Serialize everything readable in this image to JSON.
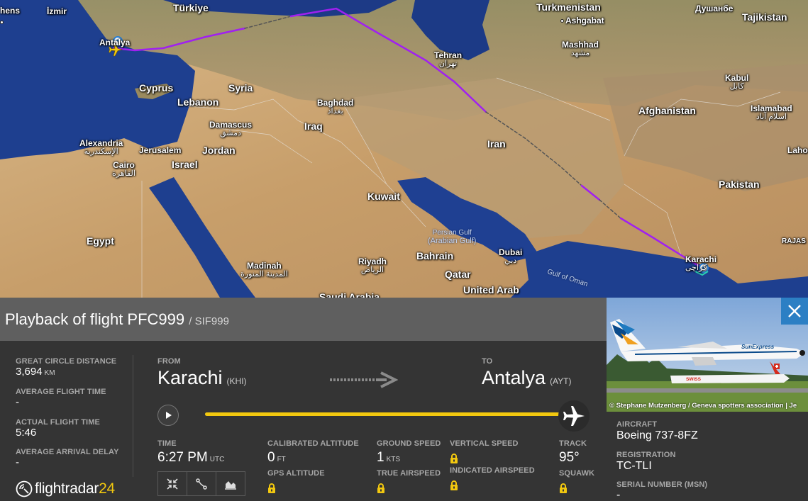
{
  "map": {
    "countries": [
      {
        "key": "turkiye",
        "name": "Türkiye"
      },
      {
        "key": "turkmenistan",
        "name": "Turkmenistan"
      },
      {
        "key": "tajikistan",
        "name": "Tajikistan"
      },
      {
        "key": "syria",
        "name": "Syria"
      },
      {
        "key": "cyprus",
        "name": "Cyprus"
      },
      {
        "key": "lebanon",
        "name": "Lebanon"
      },
      {
        "key": "jordan",
        "name": "Jordan"
      },
      {
        "key": "israel",
        "name": "Israel"
      },
      {
        "key": "iraq",
        "name": "Iraq"
      },
      {
        "key": "iran",
        "name": "Iran"
      },
      {
        "key": "afghanistan",
        "name": "Afghanistan"
      },
      {
        "key": "pakistan",
        "name": "Pakistan"
      },
      {
        "key": "kuwait",
        "name": "Kuwait"
      },
      {
        "key": "bahrain",
        "name": "Bahrain"
      },
      {
        "key": "qatar",
        "name": "Qatar"
      },
      {
        "key": "uae",
        "name": "United Arab"
      },
      {
        "key": "egypt",
        "name": "Egypt"
      },
      {
        "key": "saudi",
        "name": "Saudi Arabia"
      },
      {
        "key": "rajas",
        "name": "RAJAS"
      }
    ],
    "cities": [
      {
        "key": "izmir",
        "name": "İzmir",
        "sub": ""
      },
      {
        "key": "athens",
        "name": "hens",
        "sub": ""
      },
      {
        "key": "antalya",
        "name": "Antalya",
        "sub": ""
      },
      {
        "key": "ashgabat",
        "name": "Ashgabat",
        "sub": ""
      },
      {
        "key": "dushanbe",
        "name": "Душанбе",
        "sub": ""
      },
      {
        "key": "mashhad",
        "name": "Mashhad",
        "sub": "مشهد"
      },
      {
        "key": "tehran",
        "name": "Tehran",
        "sub": "تهران"
      },
      {
        "key": "kabul",
        "name": "Kabul",
        "sub": "کابل"
      },
      {
        "key": "islamabad",
        "name": "Islamabad",
        "sub": "اسلام آباد"
      },
      {
        "key": "lahore",
        "name": "Laho",
        "sub": ""
      },
      {
        "key": "baghdad",
        "name": "Baghdad",
        "sub": "بغداد"
      },
      {
        "key": "damascus",
        "name": "Damascus",
        "sub": "دمشق"
      },
      {
        "key": "alexandria",
        "name": "Alexandria",
        "sub": "الإسكندرية"
      },
      {
        "key": "jerusalem",
        "name": "Jerusalem",
        "sub": ""
      },
      {
        "key": "cairo",
        "name": "Cairo",
        "sub": "القاهرة"
      },
      {
        "key": "madinah",
        "name": "Madinah",
        "sub": "المدينة المنورة"
      },
      {
        "key": "riyadh",
        "name": "Riyadh",
        "sub": "الرياض"
      },
      {
        "key": "dubai",
        "name": "Dubai",
        "sub": "دبي"
      },
      {
        "key": "karachi",
        "name": "Karachi",
        "sub": "کراچی"
      }
    ],
    "seas": [
      {
        "key": "persian-gulf",
        "name": "Persian Gulf",
        "sub": "(Arabian Gulf)"
      },
      {
        "key": "gulf-oman",
        "name": "Gulf of Oman",
        "sub": ""
      }
    ],
    "colors": {
      "track": "#a020f0",
      "sea": "#1e3a8a",
      "land": "#c9a778"
    }
  },
  "panel": {
    "title": "Playback of flight PFC999",
    "title_alt": "/ SIF999",
    "stats": {
      "gc_distance_label": "GREAT CIRCLE DISTANCE",
      "gc_distance_value": "3,694",
      "gc_distance_unit": "KM",
      "avg_flight_time_label": "AVERAGE FLIGHT TIME",
      "avg_flight_time_value": "-",
      "actual_flight_time_label": "ACTUAL FLIGHT TIME",
      "actual_flight_time_value": "5:46",
      "avg_arrival_delay_label": "AVERAGE ARRIVAL DELAY",
      "avg_arrival_delay_value": "-"
    },
    "route": {
      "from_label": "FROM",
      "from_city": "Karachi",
      "from_code": "(KHI)",
      "to_label": "TO",
      "to_city": "Antalya",
      "to_code": "(AYT)"
    },
    "playback": {
      "progress": 0.97
    },
    "telemetry": {
      "time_label": "TIME",
      "time_value": "6:27 PM",
      "time_unit": "UTC",
      "cal_alt_label": "CALIBRATED ALTITUDE",
      "cal_alt_value": "0",
      "cal_alt_unit": "FT",
      "gps_alt_label": "GPS ALTITUDE",
      "ground_speed_label": "GROUND SPEED",
      "ground_speed_value": "1",
      "ground_speed_unit": "KTS",
      "true_airspeed_label": "TRUE AIRSPEED",
      "vertical_speed_label": "VERTICAL SPEED",
      "indicated_airspeed_label": "INDICATED AIRSPEED",
      "track_label": "TRACK",
      "track_value": "95°",
      "squawk_label": "SQUAWK"
    },
    "logo": {
      "text": "flightradar",
      "num": "24"
    }
  },
  "aircraft": {
    "photo_credit": "© Stephane Mutzenberg / Geneva spotters association | Je",
    "livery_text": "SunExpress",
    "bg_livery_text": "SWISS",
    "aircraft_label": "AIRCRAFT",
    "aircraft_value": "Boeing 737-8FZ",
    "registration_label": "REGISTRATION",
    "registration_value": "TC-TLI",
    "msn_label": "SERIAL NUMBER (MSN)",
    "msn_value": "-"
  }
}
